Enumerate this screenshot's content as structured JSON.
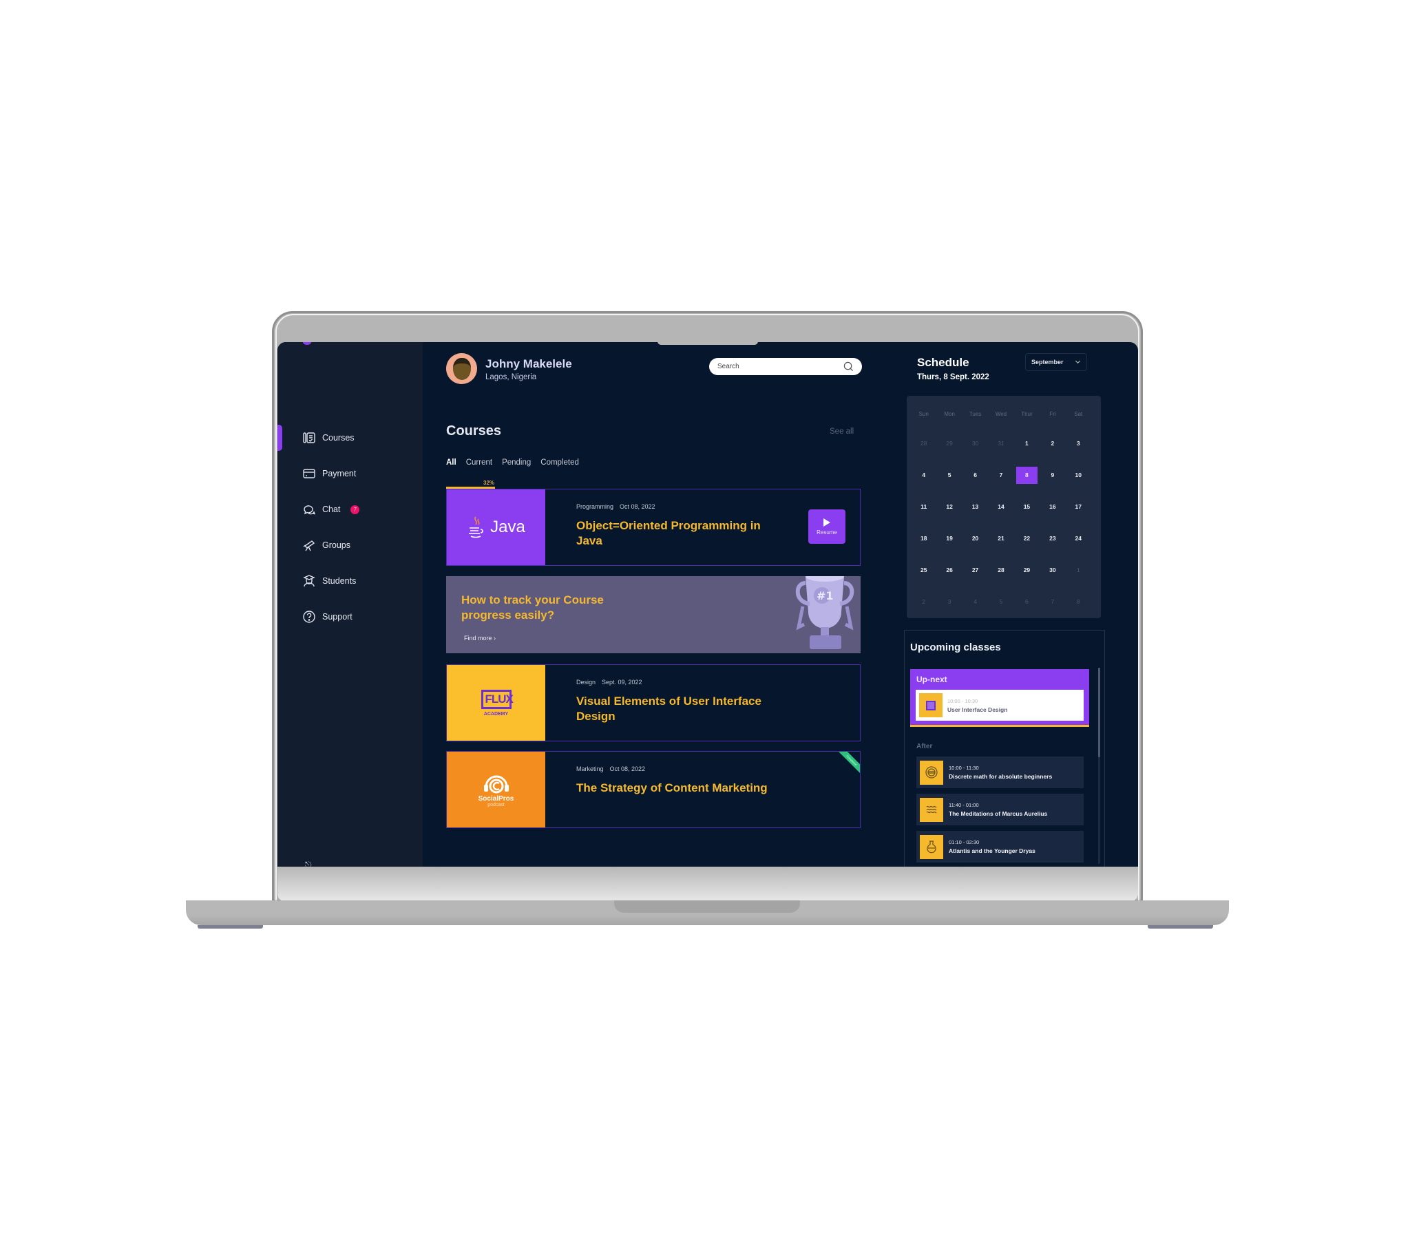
{
  "user": {
    "name": "Johny Makelele",
    "location": "Lagos, Nigeria"
  },
  "search": {
    "placeholder": "Search"
  },
  "sidebar": {
    "items": [
      {
        "label": "Courses",
        "icon": "courses-icon",
        "active": true
      },
      {
        "label": "Payment",
        "icon": "card-icon"
      },
      {
        "label": "Chat",
        "icon": "chat-icon",
        "badge": "7"
      },
      {
        "label": "Groups",
        "icon": "telescope-icon"
      },
      {
        "label": "Students",
        "icon": "student-icon"
      },
      {
        "label": "Support",
        "icon": "help-icon"
      }
    ]
  },
  "courses": {
    "title": "Courses",
    "see_all": "See all",
    "tabs": [
      "All",
      "Current",
      "Pending",
      "Completed"
    ],
    "active_tab": "All",
    "items": [
      {
        "category": "Programming",
        "date": "Oct 08, 2022",
        "title": "Object=Oriented Programming in Java",
        "thumb_text": "Java",
        "thumb_color": "#8a3ef0",
        "progress_percent": 32,
        "progress_label": "32%",
        "action": "Resume"
      },
      {
        "category": "Design",
        "date": "Sept. 09, 2022",
        "title": "Visual Elements of User Interface Design",
        "thumb_text": "FLUX",
        "thumb_subtext": "ACADEMY",
        "thumb_color": "#fbbf2d"
      },
      {
        "category": "Marketing",
        "date": "Oct 08, 2022",
        "title": "The Strategy of Content Marketing",
        "thumb_text": "SocialPros",
        "thumb_subtext": "podcast",
        "thumb_color": "#f48d1f",
        "ribbon": "Completed"
      }
    ],
    "promo": {
      "title": "How to track your Course progress easily?",
      "link": "Find more ›",
      "badge": "#1"
    }
  },
  "schedule": {
    "title": "Schedule",
    "date": "Thurs, 8 Sept. 2022",
    "month": "September",
    "weekdays": [
      "Sun",
      "Mon",
      "Tues",
      "Wed",
      "Thur",
      "Fri",
      "Sat"
    ],
    "days": [
      {
        "d": "28",
        "m": true
      },
      {
        "d": "29",
        "m": true
      },
      {
        "d": "30",
        "m": true
      },
      {
        "d": "31",
        "m": true
      },
      {
        "d": "1"
      },
      {
        "d": "2"
      },
      {
        "d": "3"
      },
      {
        "d": "4"
      },
      {
        "d": "5"
      },
      {
        "d": "6"
      },
      {
        "d": "7"
      },
      {
        "d": "8",
        "sel": true
      },
      {
        "d": "9"
      },
      {
        "d": "10"
      },
      {
        "d": "11"
      },
      {
        "d": "12"
      },
      {
        "d": "13"
      },
      {
        "d": "14"
      },
      {
        "d": "15"
      },
      {
        "d": "16"
      },
      {
        "d": "17"
      },
      {
        "d": "18"
      },
      {
        "d": "19"
      },
      {
        "d": "20"
      },
      {
        "d": "21"
      },
      {
        "d": "22"
      },
      {
        "d": "23"
      },
      {
        "d": "24"
      },
      {
        "d": "25"
      },
      {
        "d": "26"
      },
      {
        "d": "27"
      },
      {
        "d": "28"
      },
      {
        "d": "29"
      },
      {
        "d": "30"
      },
      {
        "d": "1",
        "m": true
      },
      {
        "d": "2",
        "m": true
      },
      {
        "d": "3",
        "m": true
      },
      {
        "d": "4",
        "m": true
      },
      {
        "d": "5",
        "m": true
      },
      {
        "d": "6",
        "m": true
      },
      {
        "d": "7",
        "m": true
      },
      {
        "d": "8",
        "m": true
      }
    ]
  },
  "upcoming": {
    "title": "Upcoming classes",
    "up_next_label": "Up-next",
    "up_next": {
      "time": "10:00 - 10:30",
      "name": "User Interface Design"
    },
    "after_label": "After",
    "after": [
      {
        "time": "10:00 - 11:30",
        "name": "Discrete math for absolute beginners",
        "icon": "globe-icon"
      },
      {
        "time": "11:40 - 01:00",
        "name": "The Meditations of Marcus Aurelius",
        "icon": "waves-icon"
      },
      {
        "time": "01:10 - 02:30",
        "name": "Atlantis and the Younger Dryas",
        "icon": "flask-icon"
      }
    ]
  }
}
